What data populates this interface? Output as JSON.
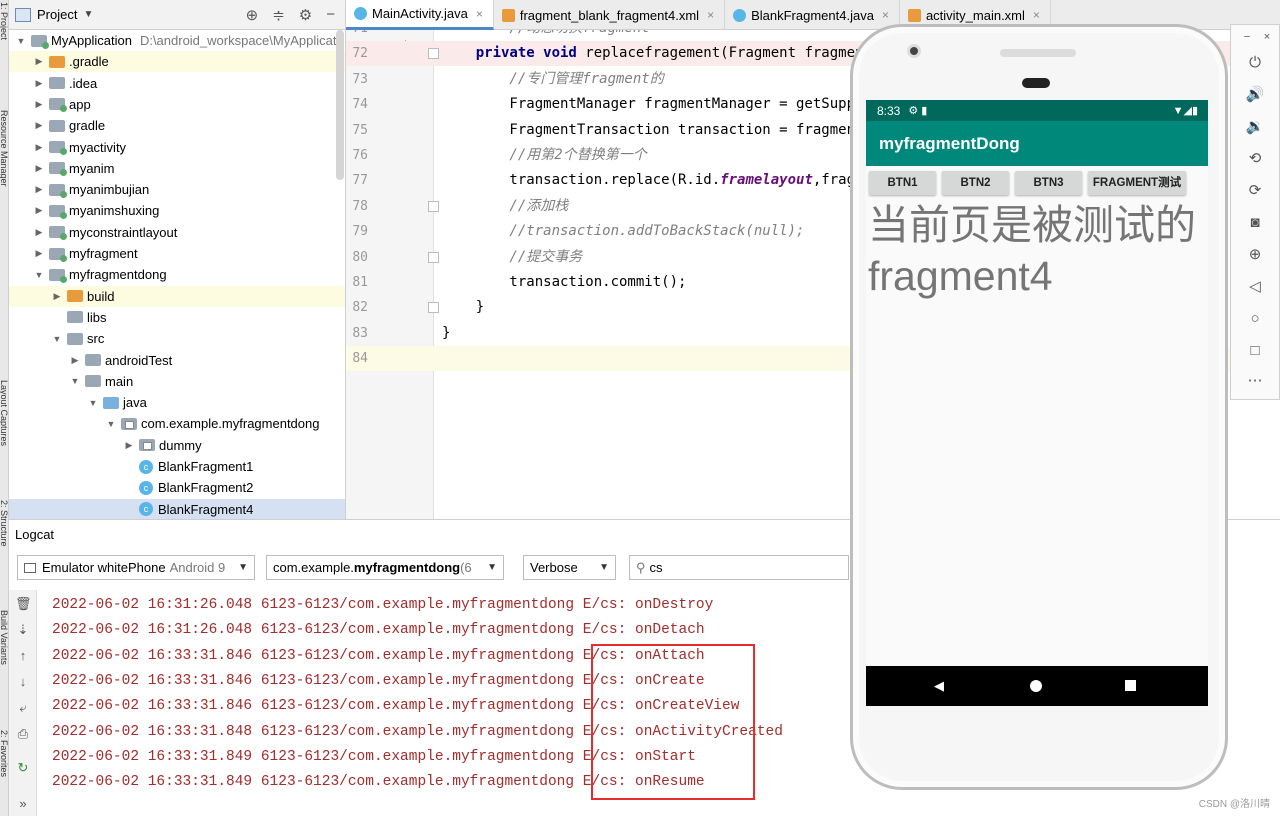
{
  "left_strip": {
    "labels": [
      "1: Project",
      "Resource Manager",
      "Layout Captures",
      "2: Structure",
      "Build Variants",
      "2: Favorites"
    ]
  },
  "project_panel": {
    "title": "Project",
    "tree": [
      {
        "label": "MyApplication",
        "path": "D:\\android_workspace\\MyApplicat",
        "depth": 0,
        "expanded": true,
        "icon": "folder-module"
      },
      {
        "label": ".gradle",
        "depth": 1,
        "expanded": false,
        "icon": "folder-orange",
        "selected": true
      },
      {
        "label": ".idea",
        "depth": 1,
        "expanded": false,
        "icon": "folder"
      },
      {
        "label": "app",
        "depth": 1,
        "expanded": false,
        "icon": "folder-module"
      },
      {
        "label": "gradle",
        "depth": 1,
        "expanded": false,
        "icon": "folder"
      },
      {
        "label": "myactivity",
        "depth": 1,
        "expanded": false,
        "icon": "folder-module"
      },
      {
        "label": "myanim",
        "depth": 1,
        "expanded": false,
        "icon": "folder-module"
      },
      {
        "label": "myanimbujian",
        "depth": 1,
        "expanded": false,
        "icon": "folder-module"
      },
      {
        "label": "myanimshuxing",
        "depth": 1,
        "expanded": false,
        "icon": "folder-module"
      },
      {
        "label": "myconstraintlayout",
        "depth": 1,
        "expanded": false,
        "icon": "folder-module"
      },
      {
        "label": "myfragment",
        "depth": 1,
        "expanded": false,
        "icon": "folder-module"
      },
      {
        "label": "myfragmentdong",
        "depth": 1,
        "expanded": true,
        "icon": "folder-module"
      },
      {
        "label": "build",
        "depth": 2,
        "expanded": false,
        "icon": "folder-orange",
        "selected": true
      },
      {
        "label": "libs",
        "depth": 2,
        "leaf": true,
        "icon": "folder"
      },
      {
        "label": "src",
        "depth": 2,
        "expanded": true,
        "icon": "folder"
      },
      {
        "label": "androidTest",
        "depth": 3,
        "expanded": false,
        "icon": "folder"
      },
      {
        "label": "main",
        "depth": 3,
        "expanded": true,
        "icon": "folder"
      },
      {
        "label": "java",
        "depth": 4,
        "expanded": true,
        "icon": "folder-blue"
      },
      {
        "label": "com.example.myfragmentdong",
        "depth": 5,
        "expanded": true,
        "icon": "folder-pkg"
      },
      {
        "label": "dummy",
        "depth": 6,
        "expanded": false,
        "icon": "folder-pkg"
      },
      {
        "label": "BlankFragment1",
        "depth": 6,
        "leaf": true,
        "icon": "class"
      },
      {
        "label": "BlankFragment2",
        "depth": 6,
        "leaf": true,
        "icon": "class"
      },
      {
        "label": "BlankFragment4",
        "depth": 6,
        "leaf": true,
        "icon": "class",
        "highlight": true
      }
    ]
  },
  "tabs": [
    {
      "label": "MainActivity.java",
      "icon": "class",
      "active": true
    },
    {
      "label": "fragment_blank_fragment4.xml",
      "icon": "xml"
    },
    {
      "label": "BlankFragment4.java",
      "icon": "class"
    },
    {
      "label": "activity_main.xml",
      "icon": "xml"
    }
  ],
  "editor": {
    "lines": [
      {
        "num": "71",
        "segments": [
          {
            "t": "        //动态切换fragment",
            "c": "cm"
          }
        ]
      },
      {
        "num": "72",
        "segments": [
          {
            "t": "    private void ",
            "c": "kw"
          },
          {
            "t": "replacefragement(Fragment fragmen",
            "c": ""
          }
        ],
        "hl": true
      },
      {
        "num": "73",
        "segments": [
          {
            "t": "        //专门管理fragment的",
            "c": "cm"
          }
        ]
      },
      {
        "num": "74",
        "segments": [
          {
            "t": "        FragmentManager fragmentManager = getSuppo",
            "c": ""
          }
        ]
      },
      {
        "num": "75",
        "segments": [
          {
            "t": "        FragmentTransaction transaction = fragment",
            "c": ""
          }
        ]
      },
      {
        "num": "76",
        "segments": [
          {
            "t": "        //用第2个替换第一个",
            "c": "cm"
          }
        ]
      },
      {
        "num": "77",
        "segments": [
          {
            "t": "        transaction.replace(R.id.",
            "c": ""
          },
          {
            "t": "framelayout",
            "c": "fld"
          },
          {
            "t": ",frag",
            "c": ""
          }
        ]
      },
      {
        "num": "78",
        "segments": [
          {
            "t": "        //添加栈",
            "c": "cm"
          }
        ]
      },
      {
        "num": "79",
        "segments": [
          {
            "t": "        //transaction.addToBackStack(null);",
            "c": "cm"
          }
        ]
      },
      {
        "num": "80",
        "segments": [
          {
            "t": "        //提交事务",
            "c": "cm"
          }
        ]
      },
      {
        "num": "81",
        "segments": [
          {
            "t": "        transaction.commit();",
            "c": ""
          }
        ]
      },
      {
        "num": "82",
        "segments": [
          {
            "t": "    }",
            "c": ""
          }
        ]
      },
      {
        "num": "83",
        "segments": [
          {
            "t": "}",
            "c": ""
          }
        ]
      },
      {
        "num": "84",
        "segments": [
          {
            "t": "",
            "c": ""
          }
        ],
        "cur": true
      }
    ]
  },
  "logcat": {
    "title": "Logcat",
    "device": {
      "name": "Emulator whitePhone",
      "detail": "Android 9"
    },
    "process": {
      "prefix": "com.example.",
      "bold": "myfragmentdong",
      "suffix": " (6"
    },
    "level": "Verbose",
    "search": "cs",
    "lines": [
      "2022-06-02 16:31:26.048 6123-6123/com.example.myfragmentdong E/cs: onDestroy",
      "2022-06-02 16:31:26.048 6123-6123/com.example.myfragmentdong E/cs: onDetach",
      "2022-06-02 16:33:31.846 6123-6123/com.example.myfragmentdong E/cs: onAttach",
      "2022-06-02 16:33:31.846 6123-6123/com.example.myfragmentdong E/cs: onCreate",
      "2022-06-02 16:33:31.846 6123-6123/com.example.myfragmentdong E/cs: onCreateView",
      "2022-06-02 16:33:31.848 6123-6123/com.example.myfragmentdong E/cs: onActivityCreated",
      "2022-06-02 16:33:31.849 6123-6123/com.example.myfragmentdong E/cs: onStart",
      "2022-06-02 16:33:31.849 6123-6123/com.example.myfragmentdong E/cs: onResume"
    ],
    "log_color": "#a32c2c",
    "highlight_color": "#e82b2b"
  },
  "emulator": {
    "time": "8:33",
    "app_title": "myfragmentDong",
    "buttons": [
      "BTN1",
      "BTN2",
      "BTN3",
      "FRAGMENT测试"
    ],
    "fragment_text": "当前页是被测试的fragment4",
    "colors": {
      "status": "#00695c",
      "appbar": "#00897b"
    }
  },
  "watermark": "CSDN @洛川晴"
}
